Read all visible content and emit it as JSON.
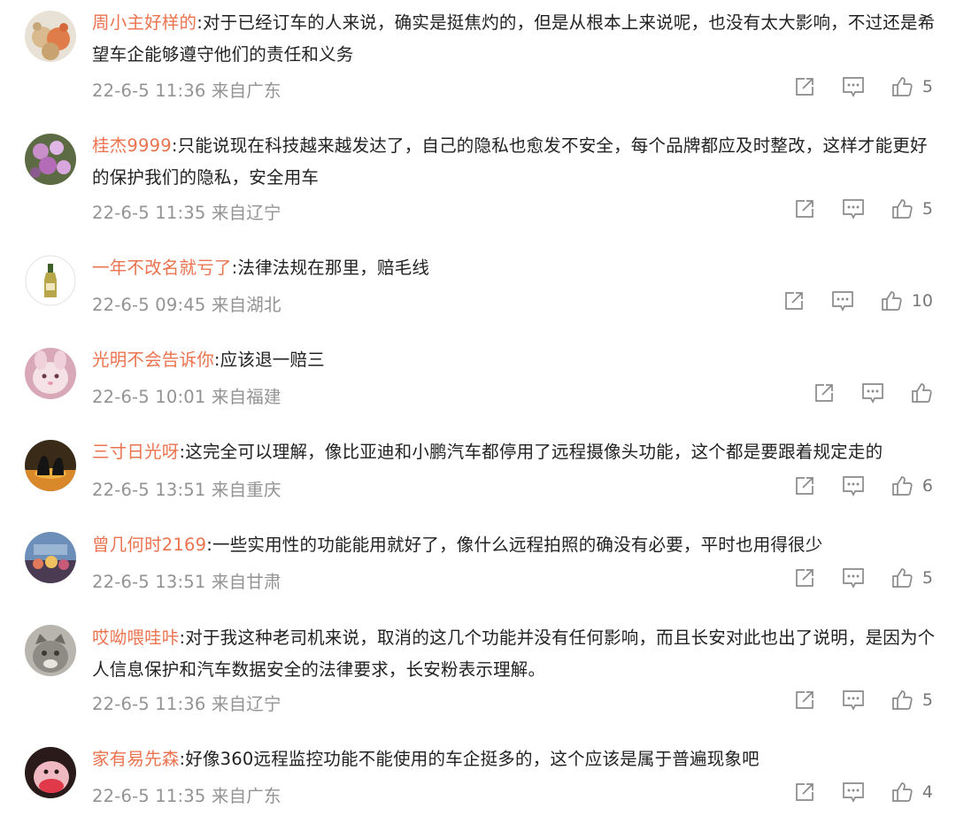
{
  "comments": [
    {
      "user": "周小主好样的",
      "text": ":对于已经订车的人来说，确实是挺焦灼的，但是从根本上来说呢，也没有太大影响，不过还是希望车企能够遵守他们的责任和义务",
      "time": "22-6-5 11:36",
      "location": "来自广东",
      "likes": "5"
    },
    {
      "user": "桂杰9999",
      "text": ":只能说现在科技越来越发达了，自己的隐私也愈发不安全，每个品牌都应及时整改，这样才能更好的保护我们的隐私，安全用车",
      "time": "22-6-5 11:35",
      "location": "来自辽宁",
      "likes": "5"
    },
    {
      "user": "一年不改名就亏了",
      "text": ":法律法规在那里，赔毛线",
      "time": "22-6-5 09:45",
      "location": "来自湖北",
      "likes": "10"
    },
    {
      "user": "光明不会告诉你",
      "text": ":应该退一赔三",
      "time": "22-6-5 10:01",
      "location": "来自福建",
      "likes": ""
    },
    {
      "user": "三寸日光呀",
      "text": ":这完全可以理解，像比亚迪和小鹏汽车都停用了远程摄像头功能，这个都是要跟着规定走的",
      "time": "22-6-5 13:51",
      "location": "来自重庆",
      "likes": "6"
    },
    {
      "user": "曾几何时2169",
      "text": ":一些实用性的功能能用就好了，像什么远程拍照的确没有必要，平时也用得很少",
      "time": "22-6-5 13:51",
      "location": "来自甘肃",
      "likes": "5"
    },
    {
      "user": "哎呦喂哇咔",
      "text": ":对于我这种老司机来说，取消的这几个功能并没有任何影响，而且长安对此也出了说明，是因为个人信息保护和汽车数据安全的法律要求，长安粉表示理解。",
      "time": "22-6-5 11:36",
      "location": "来自辽宁",
      "likes": "5"
    },
    {
      "user": "家有易先森",
      "text": ":好像360远程监控功能不能使用的车企挺多的，这个应该是属于普遍现象吧",
      "time": "22-6-5 11:35",
      "location": "来自广东",
      "likes": "4"
    }
  ],
  "icons": {
    "share": "share-icon",
    "comment": "comment-icon",
    "like": "like-icon"
  },
  "colors": {
    "username": "#eb7350",
    "meta": "#939393",
    "text": "#222222"
  }
}
